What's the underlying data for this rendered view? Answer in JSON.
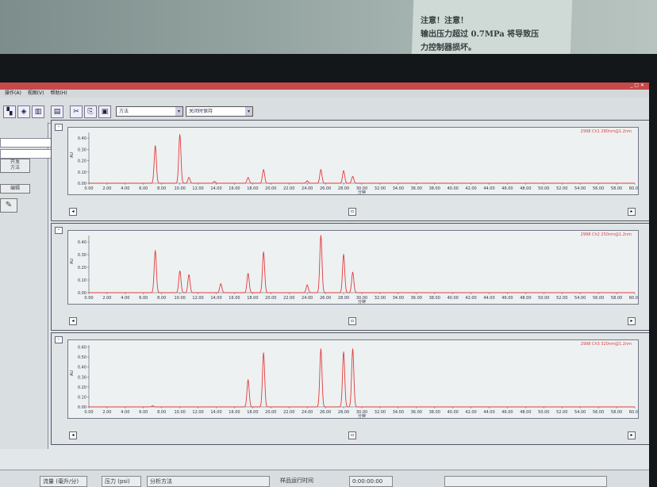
{
  "surroundings": {
    "notice_lines": [
      "注意！注意！",
      "输出压力超过 0.7MPa 将导致压",
      "力控制器损坏。"
    ]
  },
  "window": {
    "title": "",
    "menu": [
      "操作(A)",
      "视图(V)",
      "帮助(H)"
    ]
  },
  "toolbar": {
    "combo1": "方法",
    "combo2": "关闭时保持"
  },
  "left_panel": {
    "button_analysis": "开发\n方法",
    "button_edit": "编辑"
  },
  "colors": {
    "trace": "#e43a3a",
    "plot_bg": "#edf1f2"
  },
  "x_axis": {
    "unit": "分钟",
    "ticks": [
      "0.00",
      "2.00",
      "4.00",
      "6.00",
      "8.00",
      "10.00",
      "12.00",
      "14.00",
      "16.00",
      "18.00",
      "20.00",
      "22.00",
      "24.00",
      "26.00",
      "28.00",
      "30.00",
      "32.00",
      "34.00",
      "36.00",
      "38.00",
      "40.00",
      "42.00",
      "44.00",
      "46.00",
      "48.00",
      "50.00",
      "52.00",
      "54.00",
      "56.00",
      "58.00",
      "60.00"
    ],
    "min": 0,
    "max": 60
  },
  "chart_data": [
    {
      "type": "line",
      "legend": "2998 Ch1 280nm@1.2nm",
      "y_unit": "AU",
      "yticks": [
        "0.00",
        "0.10",
        "0.20",
        "0.30",
        "0.40"
      ],
      "ylim": [
        0,
        0.45
      ],
      "peaks": [
        [
          7.3,
          0.33
        ],
        [
          10.0,
          0.43
        ],
        [
          11.0,
          0.05
        ],
        [
          13.8,
          0.015
        ],
        [
          17.5,
          0.05
        ],
        [
          19.2,
          0.12
        ],
        [
          24.0,
          0.02
        ],
        [
          25.5,
          0.12
        ],
        [
          28.0,
          0.11
        ],
        [
          29.0,
          0.06
        ]
      ]
    },
    {
      "type": "line",
      "legend": "2998 Ch2 250nm@1.2nm",
      "y_unit": "AU",
      "yticks": [
        "0.00",
        "0.10",
        "0.20",
        "0.30",
        "0.40"
      ],
      "ylim": [
        0,
        0.45
      ],
      "peaks": [
        [
          7.3,
          0.33
        ],
        [
          10.0,
          0.17
        ],
        [
          11.0,
          0.14
        ],
        [
          14.5,
          0.07
        ],
        [
          17.5,
          0.15
        ],
        [
          19.2,
          0.32
        ],
        [
          24.0,
          0.06
        ],
        [
          25.5,
          0.45
        ],
        [
          28.0,
          0.3
        ],
        [
          29.0,
          0.16
        ]
      ]
    },
    {
      "type": "line",
      "legend": "2998 Ch3 320nm@1.2nm",
      "y_unit": "AU",
      "yticks": [
        "0.00",
        "0.10",
        "0.20",
        "0.30",
        "0.40",
        "0.50",
        "0.60"
      ],
      "ylim": [
        0,
        0.62
      ],
      "peaks": [
        [
          7.0,
          0.01
        ],
        [
          17.5,
          0.27
        ],
        [
          19.2,
          0.54
        ],
        [
          25.5,
          0.58
        ],
        [
          28.0,
          0.55
        ],
        [
          29.0,
          0.58
        ]
      ]
    }
  ],
  "status": {
    "flow_label": "流量 (毫升/分)",
    "pressure_label": "压力 (psi)",
    "method_label": "分析方法",
    "runtime_label": "样品运行时间",
    "runtime_value": "0:00:00:00"
  }
}
